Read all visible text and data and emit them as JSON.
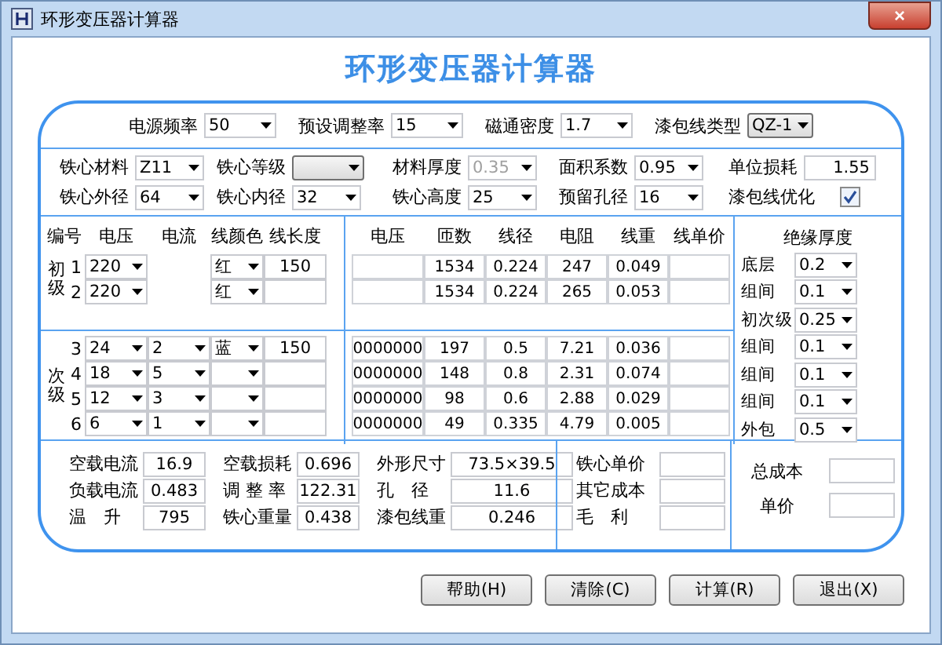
{
  "window": {
    "title": "环形变压器计算器",
    "close": "×"
  },
  "heading": "环形变压器计算器",
  "top_settings": [
    {
      "label": "电源频率",
      "value": "50",
      "kind": "combo"
    },
    {
      "label": "预设调整率",
      "value": "15",
      "kind": "combo"
    },
    {
      "label": "磁通密度",
      "value": "1.7",
      "kind": "combo"
    },
    {
      "label": "漆包线类型",
      "value": "QZ-1",
      "kind": "button-combo"
    }
  ],
  "core_params": [
    [
      {
        "label": "铁心材料",
        "value": "Z11",
        "kind": "combo",
        "disabled": false
      },
      {
        "label": "铁心等级",
        "kind": "button-combo"
      },
      {
        "label": "材料厚度",
        "value": "0.35",
        "kind": "combo",
        "disabled": true
      },
      {
        "label": "面积系数",
        "value": "0.95",
        "kind": "combo",
        "disabled": false
      },
      {
        "label": "单位损耗",
        "value": "1.55",
        "kind": "text"
      }
    ],
    [
      {
        "label": "铁心外径",
        "value": "64",
        "kind": "combo",
        "disabled": false
      },
      {
        "label": "铁心内径",
        "value": "32",
        "kind": "combo",
        "disabled": false
      },
      {
        "label": "铁心高度",
        "value": "25",
        "kind": "combo",
        "disabled": false
      },
      {
        "label": "预留孔径",
        "value": "16",
        "kind": "combo",
        "disabled": false
      },
      {
        "label": "漆包线优化",
        "kind": "check",
        "checked": true
      }
    ]
  ],
  "winding_headers": [
    "编号",
    "电压",
    "电流",
    "线颜色",
    "线长度"
  ],
  "result_headers": [
    "电压",
    "匝数",
    "线径",
    "电阻",
    "线重",
    "线单价"
  ],
  "primary": {
    "label": "初级",
    "rows": [
      {
        "no": "1",
        "voltage": "220",
        "wire_color": "红",
        "length": "150",
        "turns": "1534",
        "diameter": "0.224",
        "resistance": "247",
        "weight": "0.049"
      },
      {
        "no": "2",
        "voltage": "220",
        "wire_color": "红",
        "turns": "1534",
        "diameter": "0.224",
        "resistance": "265",
        "weight": "0.053"
      }
    ]
  },
  "secondary": {
    "label": "次级",
    "rows": [
      {
        "no": "3",
        "voltage": "24",
        "current": "2",
        "wire_color": "蓝",
        "length": "150",
        "out_voltage": "0000000",
        "turns": "197",
        "diameter": "0.5",
        "resistance": "7.21",
        "weight": "0.036"
      },
      {
        "no": "4",
        "voltage": "18",
        "current": "5",
        "out_voltage": "0000000",
        "turns": "148",
        "diameter": "0.8",
        "resistance": "2.31",
        "weight": "0.074"
      },
      {
        "no": "5",
        "voltage": "12",
        "current": "3",
        "out_voltage": "0000000",
        "turns": "98",
        "diameter": "0.6",
        "resistance": "2.88",
        "weight": "0.029"
      },
      {
        "no": "6",
        "voltage": "6",
        "current": "1",
        "out_voltage": "0000000",
        "turns": "49",
        "diameter": "0.335",
        "resistance": "4.79",
        "weight": "0.005"
      }
    ]
  },
  "insulation": {
    "title": "绝缘厚度",
    "items": [
      {
        "label": "底层",
        "value": "0.2"
      },
      {
        "label": "组间",
        "value": "0.1"
      },
      {
        "label": "初次级",
        "value": "0.25"
      },
      {
        "label": "组间",
        "value": "0.1"
      },
      {
        "label": "组间",
        "value": "0.1"
      },
      {
        "label": "组间",
        "value": "0.1"
      },
      {
        "label": "外包",
        "value": "0.5"
      }
    ]
  },
  "results": [
    [
      {
        "label": "空载电流",
        "value": "16.9"
      },
      {
        "label": "负载电流",
        "value": "0.483"
      },
      {
        "label": "温　升",
        "value": "795"
      }
    ],
    [
      {
        "label": "空载损耗",
        "value": "0.696"
      },
      {
        "label": "调 整 率",
        "value": "122.31"
      },
      {
        "label": "铁心重量",
        "value": "0.438"
      }
    ],
    [
      {
        "label": "外形尺寸",
        "value": "73.5×39.5"
      },
      {
        "label": "孔　径",
        "value": "11.6"
      },
      {
        "label": "漆包线重",
        "value": "0.246"
      }
    ]
  ],
  "costs": [
    {
      "label": "铁心单价"
    },
    {
      "label": "其它成本"
    },
    {
      "label": "毛　利"
    }
  ],
  "totals": [
    {
      "label": "总成本"
    },
    {
      "label": "单价"
    }
  ],
  "buttons": [
    "帮助(H)",
    "清除(C)",
    "计算(R)",
    "退出(X)"
  ]
}
